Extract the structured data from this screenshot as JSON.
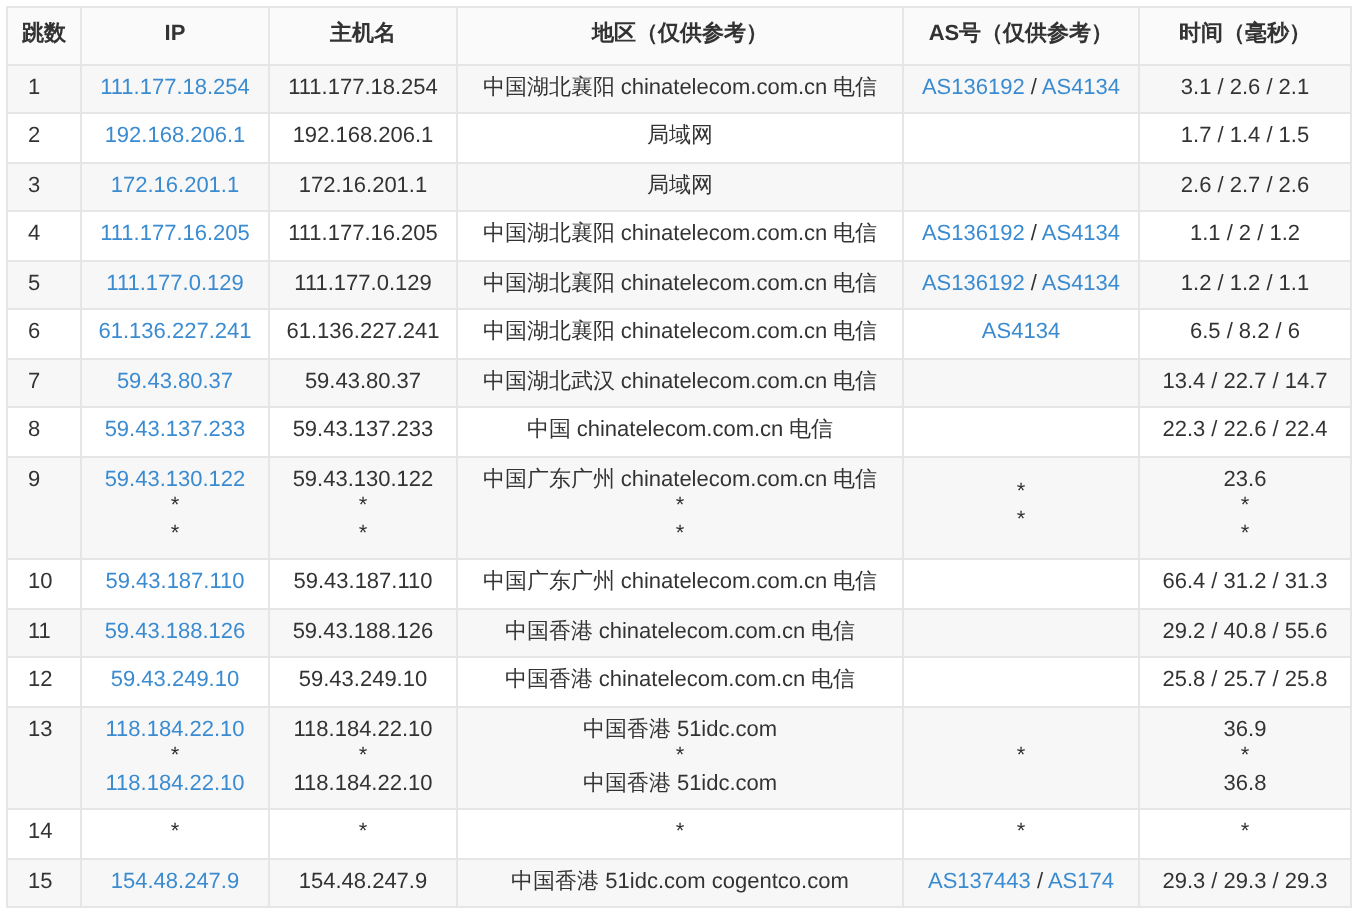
{
  "table": {
    "columns": [
      "跳数",
      "IP",
      "主机名",
      "地区（仅供参考）",
      "AS号（仅供参考）",
      "时间（毫秒）"
    ],
    "rows": [
      {
        "hop": "1",
        "ip": [
          {
            "text": "111.177.18.254",
            "link": true
          }
        ],
        "host": [
          "111.177.18.254"
        ],
        "region": [
          "中国湖北襄阳 chinatelecom.com.cn 电信"
        ],
        "asn": [
          [
            {
              "text": "AS136192",
              "link": true
            },
            {
              "text": " / ",
              "link": false
            },
            {
              "text": "AS4134",
              "link": true
            }
          ]
        ],
        "time": [
          "3.1 / 2.6 / 2.1"
        ]
      },
      {
        "hop": "2",
        "ip": [
          {
            "text": "192.168.206.1",
            "link": true
          }
        ],
        "host": [
          "192.168.206.1"
        ],
        "region": [
          "局域网"
        ],
        "asn": [],
        "time": [
          "1.7 / 1.4 / 1.5"
        ]
      },
      {
        "hop": "3",
        "ip": [
          {
            "text": "172.16.201.1",
            "link": true
          }
        ],
        "host": [
          "172.16.201.1"
        ],
        "region": [
          "局域网"
        ],
        "asn": [],
        "time": [
          "2.6 / 2.7 / 2.6"
        ]
      },
      {
        "hop": "4",
        "ip": [
          {
            "text": "111.177.16.205",
            "link": true
          }
        ],
        "host": [
          "111.177.16.205"
        ],
        "region": [
          "中国湖北襄阳 chinatelecom.com.cn 电信"
        ],
        "asn": [
          [
            {
              "text": "AS136192",
              "link": true
            },
            {
              "text": " / ",
              "link": false
            },
            {
              "text": "AS4134",
              "link": true
            }
          ]
        ],
        "time": [
          "1.1 / 2 / 1.2"
        ]
      },
      {
        "hop": "5",
        "ip": [
          {
            "text": "111.177.0.129",
            "link": true
          }
        ],
        "host": [
          "111.177.0.129"
        ],
        "region": [
          "中国湖北襄阳 chinatelecom.com.cn 电信"
        ],
        "asn": [
          [
            {
              "text": "AS136192",
              "link": true
            },
            {
              "text": " / ",
              "link": false
            },
            {
              "text": "AS4134",
              "link": true
            }
          ]
        ],
        "time": [
          "1.2 / 1.2 / 1.1"
        ]
      },
      {
        "hop": "6",
        "ip": [
          {
            "text": "61.136.227.241",
            "link": true
          }
        ],
        "host": [
          "61.136.227.241"
        ],
        "region": [
          "中国湖北襄阳 chinatelecom.com.cn 电信"
        ],
        "asn": [
          [
            {
              "text": "AS4134",
              "link": true
            }
          ]
        ],
        "time": [
          "6.5 / 8.2 / 6"
        ]
      },
      {
        "hop": "7",
        "ip": [
          {
            "text": "59.43.80.37",
            "link": true
          }
        ],
        "host": [
          "59.43.80.37"
        ],
        "region": [
          "中国湖北武汉 chinatelecom.com.cn 电信"
        ],
        "asn": [],
        "time": [
          "13.4 / 22.7 / 14.7"
        ]
      },
      {
        "hop": "8",
        "ip": [
          {
            "text": "59.43.137.233",
            "link": true
          }
        ],
        "host": [
          "59.43.137.233"
        ],
        "region": [
          "中国 chinatelecom.com.cn 电信"
        ],
        "asn": [],
        "time": [
          "22.3 / 22.6 / 22.4"
        ]
      },
      {
        "hop": "9",
        "ip": [
          {
            "text": "59.43.130.122",
            "link": true
          },
          {
            "text": "*",
            "link": false
          },
          {
            "text": "*",
            "link": false
          }
        ],
        "host": [
          "59.43.130.122",
          "*",
          "*"
        ],
        "region": [
          "中国广东广州 chinatelecom.com.cn 电信",
          "*",
          "*"
        ],
        "asn": [
          [
            {
              "text": "*",
              "link": false
            }
          ],
          [
            {
              "text": "*",
              "link": false
            }
          ]
        ],
        "time": [
          "23.6",
          "*",
          "*"
        ]
      },
      {
        "hop": "10",
        "ip": [
          {
            "text": "59.43.187.110",
            "link": true
          }
        ],
        "host": [
          "59.43.187.110"
        ],
        "region": [
          "中国广东广州 chinatelecom.com.cn 电信"
        ],
        "asn": [],
        "time": [
          "66.4 / 31.2 / 31.3"
        ]
      },
      {
        "hop": "11",
        "ip": [
          {
            "text": "59.43.188.126",
            "link": true
          }
        ],
        "host": [
          "59.43.188.126"
        ],
        "region": [
          "中国香港 chinatelecom.com.cn 电信"
        ],
        "asn": [],
        "time": [
          "29.2 / 40.8 / 55.6"
        ]
      },
      {
        "hop": "12",
        "ip": [
          {
            "text": "59.43.249.10",
            "link": true
          }
        ],
        "host": [
          "59.43.249.10"
        ],
        "region": [
          "中国香港 chinatelecom.com.cn 电信"
        ],
        "asn": [],
        "time": [
          "25.8 / 25.7 / 25.8"
        ]
      },
      {
        "hop": "13",
        "ip": [
          {
            "text": "118.184.22.10",
            "link": true
          },
          {
            "text": "*",
            "link": false
          },
          {
            "text": "118.184.22.10",
            "link": true
          }
        ],
        "host": [
          "118.184.22.10",
          "*",
          "118.184.22.10"
        ],
        "region": [
          "中国香港 51idc.com",
          "*",
          "中国香港 51idc.com"
        ],
        "asn": [
          [
            {
              "text": "*",
              "link": false
            }
          ]
        ],
        "time": [
          "36.9",
          "*",
          "36.8"
        ]
      },
      {
        "hop": "14",
        "ip": [
          {
            "text": "*",
            "link": false
          }
        ],
        "host": [
          "*"
        ],
        "region": [
          "*"
        ],
        "asn": [
          [
            {
              "text": "*",
              "link": false
            }
          ]
        ],
        "time": [
          "*"
        ]
      },
      {
        "hop": "15",
        "ip": [
          {
            "text": "154.48.247.9",
            "link": true
          }
        ],
        "host": [
          "154.48.247.9"
        ],
        "region": [
          "中国香港 51idc.com cogentco.com"
        ],
        "asn": [
          [
            {
              "text": "AS137443",
              "link": true
            },
            {
              "text": " / ",
              "link": false
            },
            {
              "text": "AS174",
              "link": true
            }
          ]
        ],
        "time": [
          "29.3 / 29.3 / 29.3"
        ]
      }
    ]
  }
}
